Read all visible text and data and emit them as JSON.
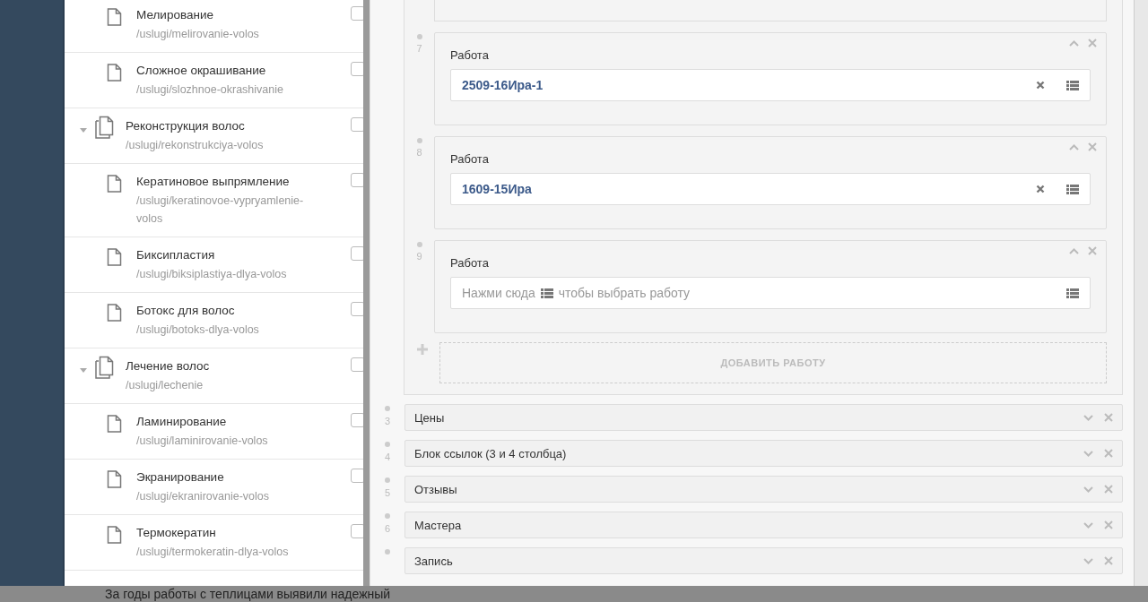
{
  "tree": {
    "items": [
      {
        "kind": "page",
        "title": "Мелирование",
        "path": "/uslugi/melirovanie-volos",
        "checked": false
      },
      {
        "kind": "page",
        "title": "Сложное окрашивание",
        "path": "/uslugi/slozhnoe-okrashivanie",
        "checked": false
      },
      {
        "kind": "section",
        "title": "Реконструкция волос",
        "path": "/uslugi/rekonstrukciya-volos",
        "checked": false,
        "expanded": true,
        "children": [
          {
            "kind": "page",
            "title": "Кератиновое выпрямление",
            "path": "/uslugi/keratinovoe-vypryamlenie-volos",
            "checked": false
          },
          {
            "kind": "page",
            "title": "Биксипластия",
            "path": "/uslugi/biksiplastiya-dlya-volos",
            "checked": false
          },
          {
            "kind": "page",
            "title": "Ботокс для волос",
            "path": "/uslugi/botoks-dlya-volos",
            "checked": false
          }
        ]
      },
      {
        "kind": "section",
        "title": "Лечение волос",
        "path": "/uslugi/lechenie",
        "checked": false,
        "expanded": true,
        "children": [
          {
            "kind": "page",
            "title": "Ламинирование",
            "path": "/uslugi/laminirovanie-volos",
            "checked": false
          },
          {
            "kind": "page",
            "title": "Экранирование",
            "path": "/uslugi/ekranirovanie-volos",
            "checked": false
          },
          {
            "kind": "page",
            "title": "Термокератин",
            "path": "/uslugi/termokeratin-dlya-volos",
            "checked": false
          }
        ]
      }
    ]
  },
  "works": [
    {
      "number": "7",
      "label": "Работа",
      "value": "2509-16Ира-1"
    },
    {
      "number": "8",
      "label": "Работа",
      "value": "1609-15Ира"
    },
    {
      "number": "9",
      "label": "Работа",
      "placeholder_start": "Нажми сюда",
      "placeholder_end": "чтобы выбрать работу"
    }
  ],
  "add_button": "ДОБАВИТЬ РАБОТУ",
  "blocks": [
    {
      "number": "3",
      "title": "Цены"
    },
    {
      "number": "4",
      "title": "Блок ссылок (3 и 4 столбца)"
    },
    {
      "number": "5",
      "title": "Отзывы"
    },
    {
      "number": "6",
      "title": "Мастера"
    },
    {
      "title": "Запись"
    }
  ],
  "background_text": "За годы работы с теплицами выявили надежный"
}
